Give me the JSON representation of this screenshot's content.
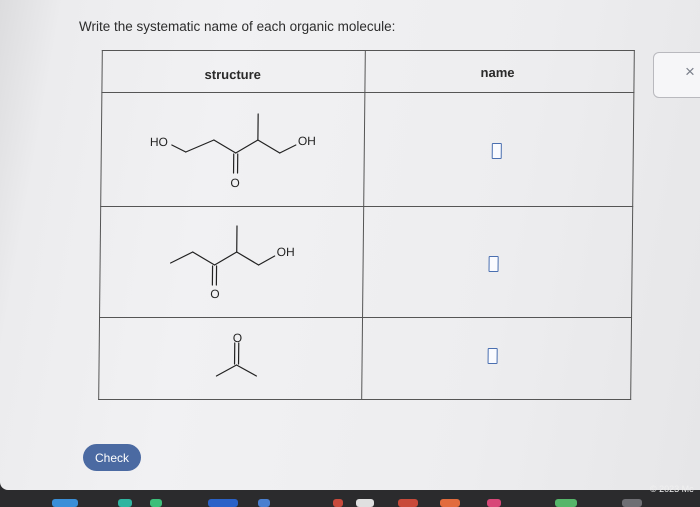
{
  "prompt": "Write the systematic name of each organic molecule:",
  "table": {
    "headers": [
      "structure",
      "name"
    ],
    "rows": [
      {
        "labels": [
          "HO",
          "OH",
          "O"
        ]
      },
      {
        "labels": [
          "OH",
          "O"
        ]
      },
      {
        "labels": [
          "O"
        ]
      }
    ]
  },
  "buttons": {
    "check": "Check",
    "close": "×"
  },
  "footer": {
    "copyright": "© 2023 Mc"
  },
  "colors": {
    "accent": "#4b6aa2",
    "answer_box": "#4a6fb0"
  }
}
